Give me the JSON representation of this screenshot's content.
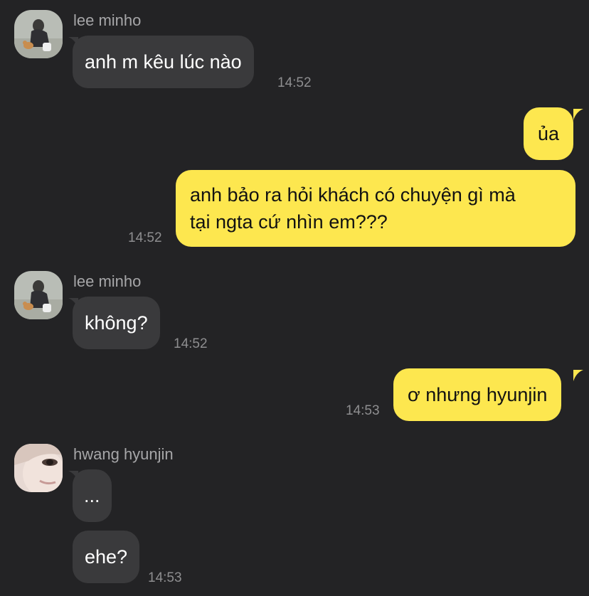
{
  "colors": {
    "background": "#232325",
    "received_bubble": "#3a3a3c",
    "sent_bubble": "#fde74f",
    "sender_name": "#a6a6a8",
    "timestamp": "#8e8e90"
  },
  "messages": [
    {
      "type": "received",
      "sender": "lee minho",
      "avatar": "lee-minho-avatar",
      "text": "anh m kêu lúc nào",
      "time": "14:52"
    },
    {
      "type": "sent",
      "text": "ủa"
    },
    {
      "type": "sent",
      "line1": "anh bảo ra hỏi khách có chuyện gì mà",
      "line2": "tại ngta cứ nhìn em???",
      "time": "14:52"
    },
    {
      "type": "received",
      "sender": "lee minho",
      "avatar": "lee-minho-avatar",
      "text": "không?",
      "time": "14:52"
    },
    {
      "type": "sent",
      "text": "ơ nhưng hyunjin",
      "time": "14:53"
    },
    {
      "type": "received",
      "sender": "hwang hyunjin",
      "avatar": "hwang-hyunjin-avatar",
      "text": "..."
    },
    {
      "type": "received",
      "text": "ehe?",
      "time": "14:53"
    }
  ]
}
